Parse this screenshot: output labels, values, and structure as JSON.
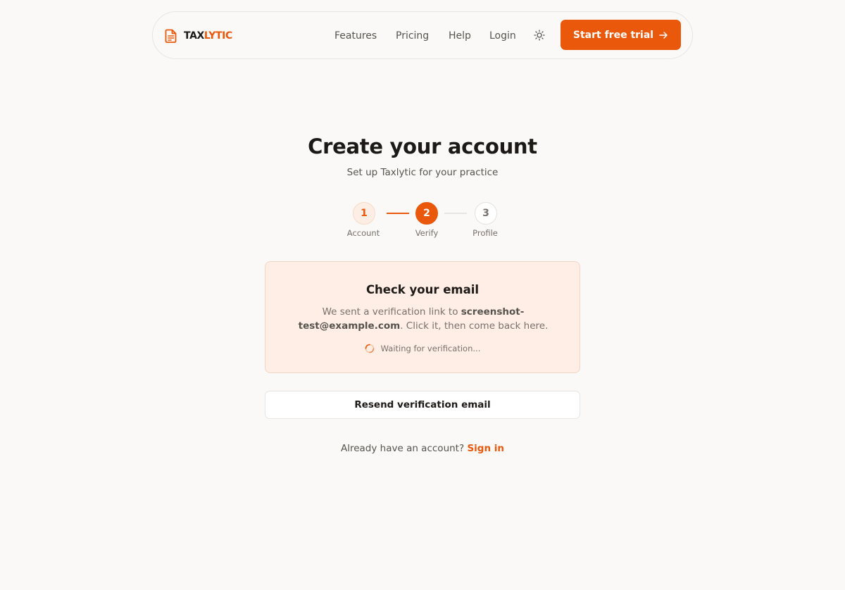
{
  "brand": {
    "part1": "TAX",
    "part2": "LYTIC",
    "icon": "document-icon"
  },
  "nav": {
    "links": [
      "Features",
      "Pricing",
      "Help",
      "Login"
    ],
    "theme_icon": "sun-icon",
    "cta_label": "Start free trial",
    "cta_icon": "arrow-right-icon"
  },
  "heading": {
    "title": "Create your account",
    "subtitle": "Set up Taxlytic for your practice"
  },
  "stepper": {
    "steps": [
      {
        "number": "1",
        "label": "Account",
        "state": "completed"
      },
      {
        "number": "2",
        "label": "Verify",
        "state": "active"
      },
      {
        "number": "3",
        "label": "Profile",
        "state": "upcoming"
      }
    ]
  },
  "verify": {
    "title": "Check your email",
    "text_before": "We sent a verification link to ",
    "email": "screenshot-test@example.com",
    "text_after": ". Click it, then come back here.",
    "status": "Waiting for verification..."
  },
  "resend_label": "Resend verification email",
  "footer": {
    "prompt": "Already have an account?",
    "link": "Sign in"
  },
  "colors": {
    "accent": "#ea580c",
    "background": "#faf9f7",
    "card_background": "#ffeee5"
  }
}
